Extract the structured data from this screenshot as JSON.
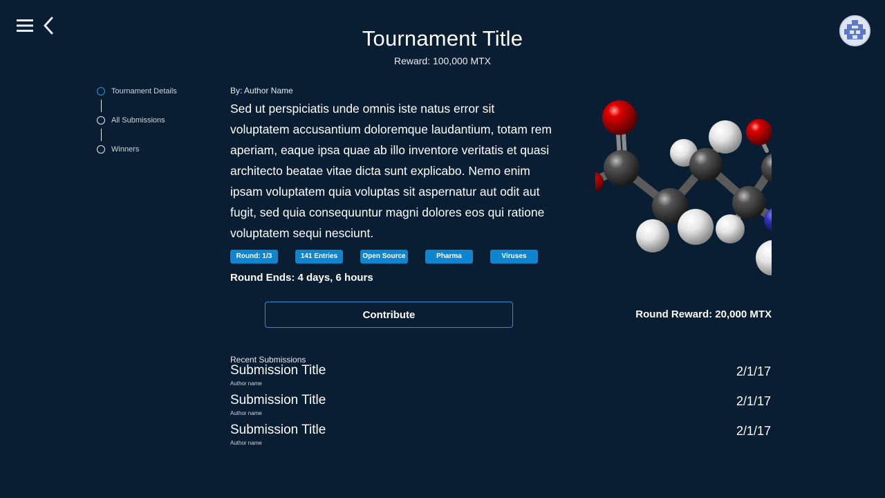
{
  "header": {
    "title": "Tournament Title",
    "reward": "Reward: 100,000 MTX"
  },
  "nav": {
    "menu_icon": "hamburger-icon",
    "back_icon": "chevron-left-icon",
    "avatar_icon": "user-avatar"
  },
  "steps": [
    {
      "label": "Tournament Details",
      "active": true
    },
    {
      "label": "All Submissions",
      "active": false
    },
    {
      "label": "Winners",
      "active": false
    }
  ],
  "main": {
    "author": "By: Author Name",
    "description": "Sed ut perspiciatis unde omnis iste natus error sit voluptatem accusantium doloremque laudantium, totam rem aperiam, eaque ipsa quae ab illo inventore veritatis et quasi architecto beatae vitae dicta sunt explicabo. Nemo enim ipsam voluptatem quia voluptas sit aspernatur aut odit aut fugit, sed quia consequuntur magni dolores eos qui ratione voluptatem sequi nesciunt.",
    "tags": [
      "Round: 1/3",
      "141 Entries",
      "Open Source",
      "Pharma",
      "Viruses"
    ],
    "round_ends": "Round Ends: 4 days, 6 hours",
    "contribute_label": "Contribute",
    "round_reward": "Round Reward: 20,000 MTX"
  },
  "recent": {
    "heading": "Recent Submissions",
    "items": [
      {
        "title": "Submission Title",
        "author": "Author name",
        "date": "2/1/17"
      },
      {
        "title": "Submission Title",
        "author": "Author name",
        "date": "2/1/17"
      },
      {
        "title": "Submission Title",
        "author": "Author name",
        "date": "2/1/17"
      }
    ]
  },
  "colors": {
    "background": "#091e33",
    "accent": "#0d85cf",
    "oxygen": "#d40000",
    "carbon": "#4a4a4a",
    "hydrogen": "#e8e8e8",
    "nitrogen": "#2d2db8"
  }
}
